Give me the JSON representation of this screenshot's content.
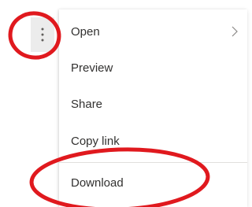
{
  "toolbar": {
    "more_icon": "more-vertical-icon"
  },
  "menu": {
    "items": [
      {
        "label": "Open",
        "icon": "chevron-right-icon"
      },
      {
        "label": "Preview"
      },
      {
        "label": "Share"
      },
      {
        "label": "Copy link"
      },
      {
        "label": "Download"
      }
    ]
  },
  "colors": {
    "annotation": "#e0191e",
    "text": "#323130",
    "button_bg": "#ececec",
    "divider": "#e1dfdd"
  }
}
